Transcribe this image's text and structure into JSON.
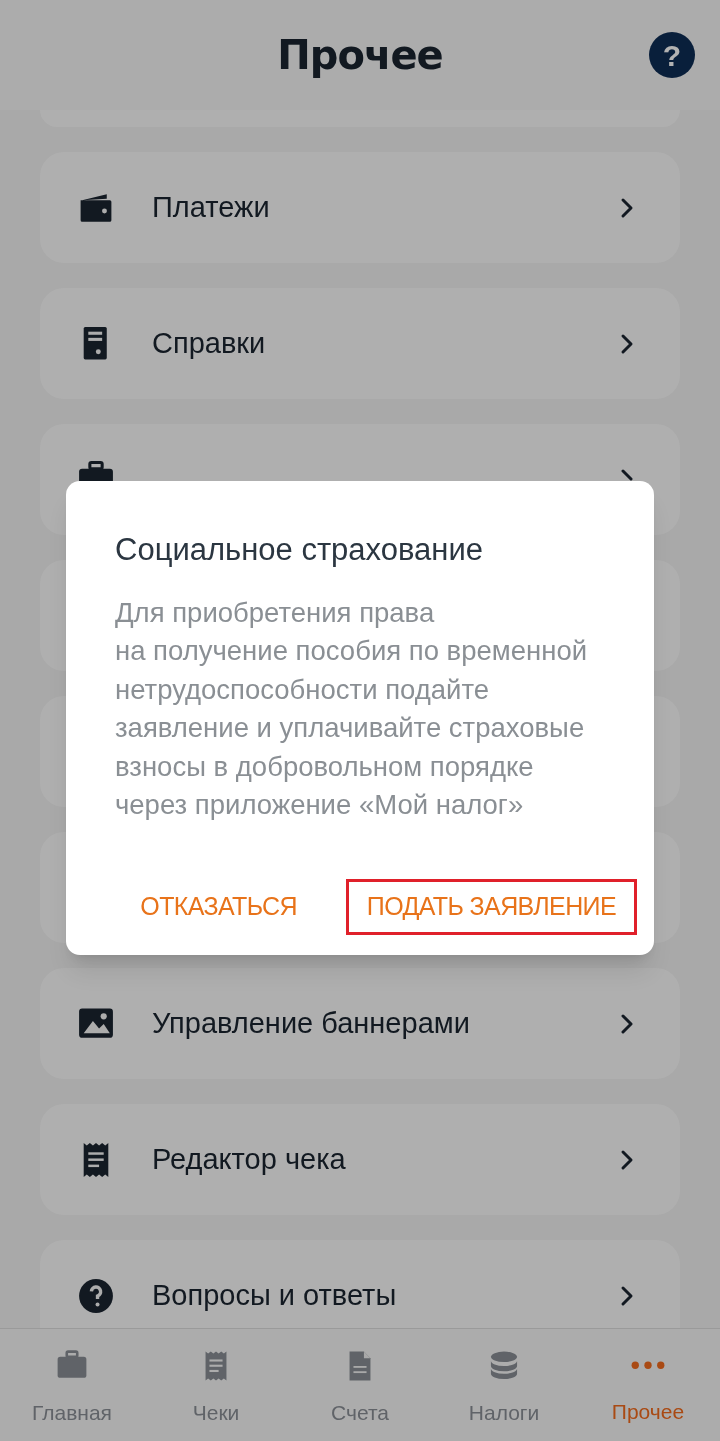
{
  "header": {
    "title": "Прочее",
    "help_icon": "?"
  },
  "menu": [
    {
      "label": "Платежи",
      "kind": "wallet"
    },
    {
      "label": "Справки",
      "kind": "doc"
    },
    {
      "kind": "briefcase"
    },
    {
      "label": "Управление баннерами",
      "kind": "image"
    },
    {
      "label": "Редактор чека",
      "kind": "receipt"
    },
    {
      "label": "Вопросы и ответы",
      "kind": "question"
    }
  ],
  "dialog": {
    "title": "Социальное страхование",
    "message": "Для приобретения права на получение пособия по временной нетрудоспособности подайте заявление и уплачивайте страховые взносы в добровольном порядке через приложение «Мой налог»",
    "buttons": [
      {
        "label": "ОТКАЗАТЬСЯ",
        "outlined": false
      },
      {
        "label": "ПОДАТЬ ЗАЯВЛЕНИЕ",
        "outlined": true
      }
    ]
  },
  "tabs": [
    {
      "label": "Главная",
      "kind": "briefcase",
      "selected": false
    },
    {
      "label": "Чеки",
      "kind": "receipt",
      "selected": false
    },
    {
      "label": "Счета",
      "kind": "file",
      "selected": false
    },
    {
      "label": "Налоги",
      "kind": "coins",
      "selected": false
    },
    {
      "label": "Прочее",
      "kind": "dots",
      "selected": true
    }
  ]
}
